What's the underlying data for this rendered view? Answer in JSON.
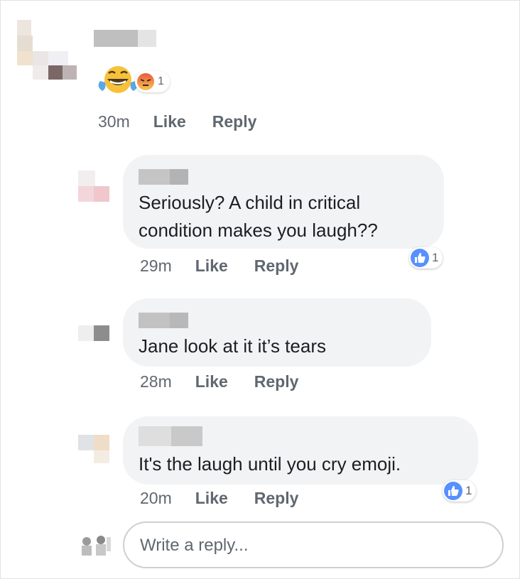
{
  "comment": {
    "reaction_count": "1",
    "time": "30m",
    "like_label": "Like",
    "reply_label": "Reply"
  },
  "replies": [
    {
      "text": "Seriously? A child in critical\ncondition makes you laugh??",
      "time": "29m",
      "like_label": "Like",
      "reply_label": "Reply",
      "reaction_count": "1"
    },
    {
      "text": "Jane look at it it’s tears",
      "time": "28m",
      "like_label": "Like",
      "reply_label": "Reply"
    },
    {
      "text": "It's the laugh until you cry emoji.",
      "time": "20m",
      "like_label": "Like",
      "reply_label": "Reply",
      "reaction_count": "1"
    }
  ],
  "reply_box": {
    "placeholder": "Write a reply..."
  },
  "colors": {
    "bubble": "#f2f3f5",
    "like_blue": "#5890ff",
    "meta_text": "#606770"
  }
}
